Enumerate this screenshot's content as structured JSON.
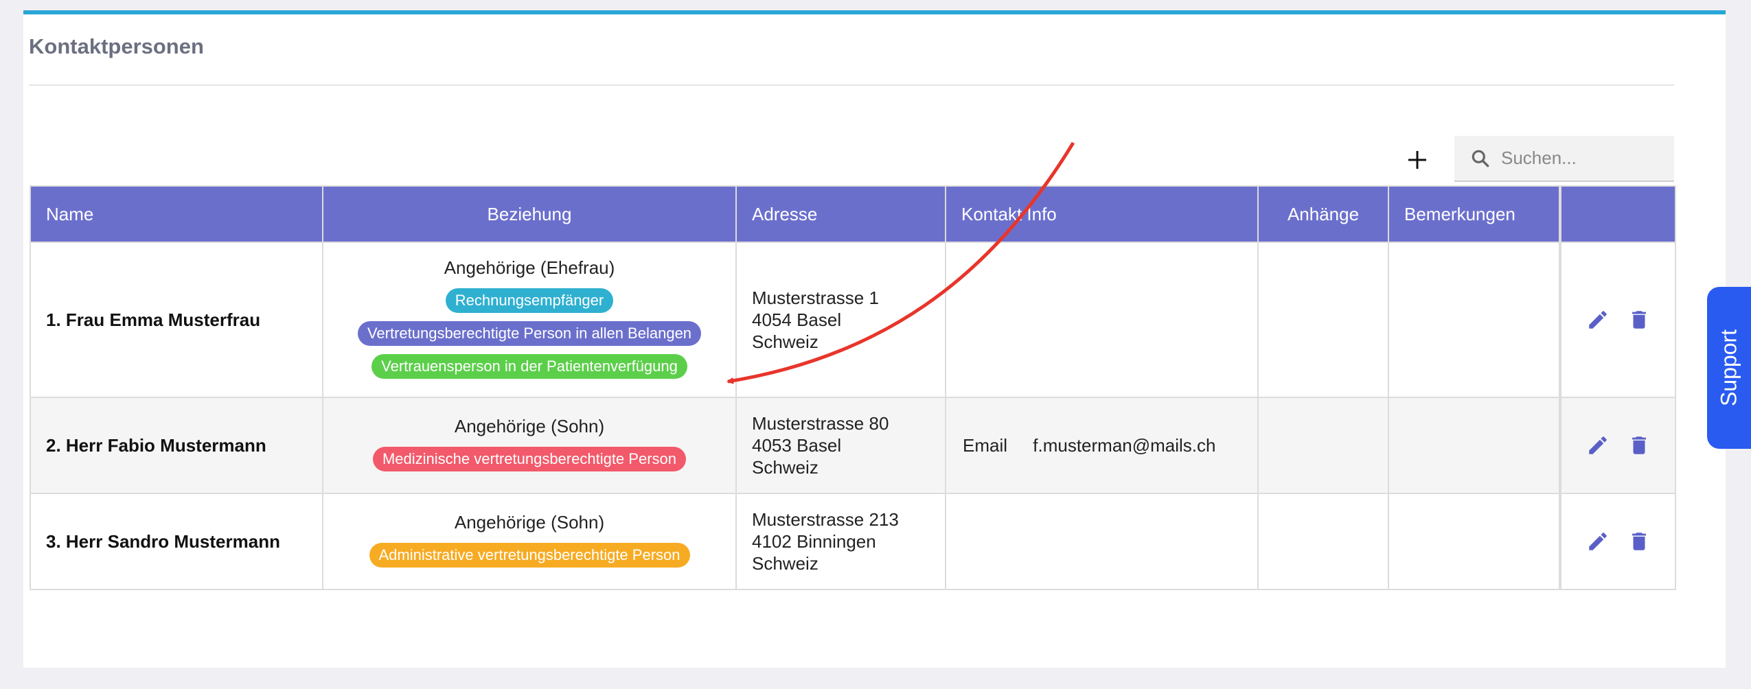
{
  "section": {
    "title": "Kontaktpersonen"
  },
  "toolbar": {
    "add_icon": "plus-icon",
    "search_placeholder": "Suchen...",
    "search_icon": "search-icon"
  },
  "table": {
    "headers": [
      "Name",
      "Beziehung",
      "Adresse",
      "Kontakt Info",
      "Anhänge",
      "Bemerkungen",
      ""
    ],
    "rows": [
      {
        "name": "1. Frau Emma Musterfrau",
        "relation": "Angehörige (Ehefrau)",
        "tags": [
          {
            "label": "Rechnungsempfänger",
            "color": "#2fb0d0"
          },
          {
            "label": "Vertretungsberechtigte Person in allen Belangen",
            "color": "#6b6fcc"
          },
          {
            "label": "Vertrauensperson in der Patientenverfügung",
            "color": "#5ccf4a"
          }
        ],
        "address": [
          "Musterstrasse 1",
          "4054 Basel",
          "Schweiz"
        ],
        "contact_label": "",
        "contact_value": ""
      },
      {
        "name": "2. Herr Fabio Mustermann",
        "relation": "Angehörige (Sohn)",
        "tags": [
          {
            "label": "Medizinische vertretungsberechtigte Person",
            "color": "#f2596a"
          }
        ],
        "address": [
          "Musterstrasse 80",
          "4053 Basel",
          "Schweiz"
        ],
        "contact_label": "Email",
        "contact_value": "f.musterman@mails.ch"
      },
      {
        "name": "3. Herr Sandro Mustermann",
        "relation": "Angehörige (Sohn)",
        "tags": [
          {
            "label": "Administrative vertretungsberechtigte Person",
            "color": "#f7ab23"
          }
        ],
        "address": [
          "Musterstrasse 213",
          "4102 Binningen",
          "Schweiz"
        ],
        "contact_label": "",
        "contact_value": ""
      }
    ],
    "row_actions": {
      "edit_icon": "pencil-icon",
      "delete_icon": "trash-icon"
    }
  },
  "support": {
    "label": "Support"
  },
  "colors": {
    "accent": "#2aa6d6",
    "header_bg": "#6b6fcc",
    "support_bg": "#2a5bf0",
    "annotation_arrow": "#e8352b"
  }
}
